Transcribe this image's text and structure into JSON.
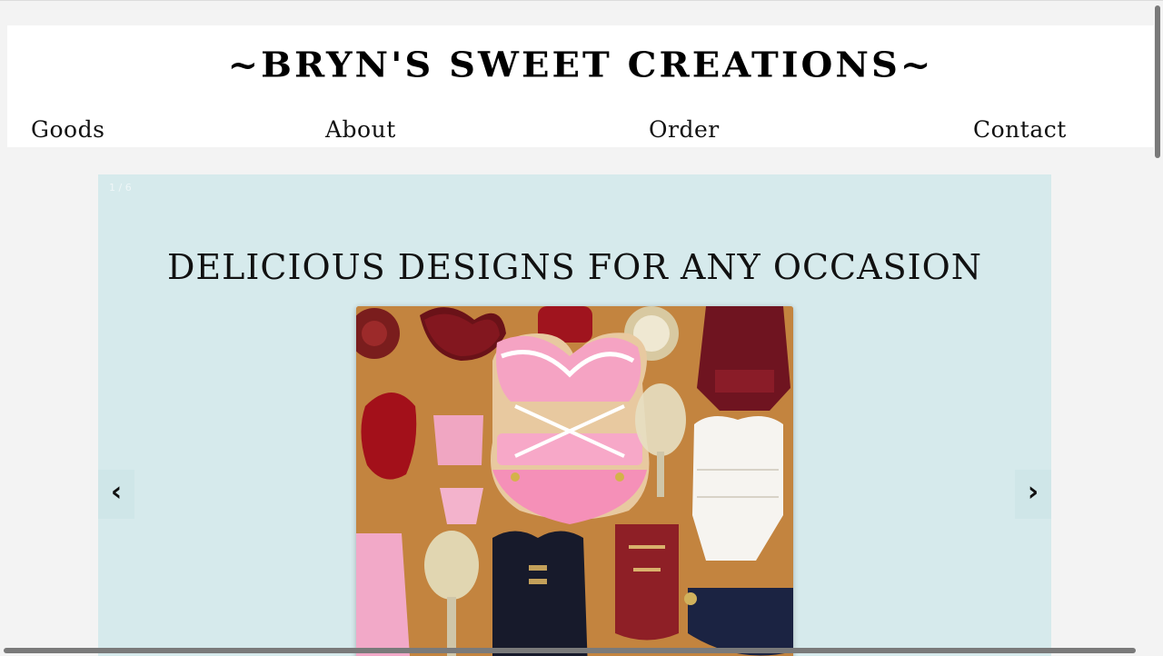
{
  "header": {
    "site_title": "~BRYN'S SWEET CREATIONS~"
  },
  "nav": {
    "items": [
      {
        "label": "Goods"
      },
      {
        "label": "About"
      },
      {
        "label": "Order"
      },
      {
        "label": "Contact"
      }
    ]
  },
  "slideshow": {
    "counter": "1 / 6",
    "heading": "DELICIOUS DESIGNS FOR ANY OCCASION",
    "image_subject": "decorated lingerie-themed sugar cookies",
    "prev_label": "‹",
    "next_label": "›",
    "background_color": "#d6eaec"
  },
  "colors": {
    "page_background": "#f3f3f3",
    "header_background": "#ffffff",
    "text": "#000000"
  }
}
